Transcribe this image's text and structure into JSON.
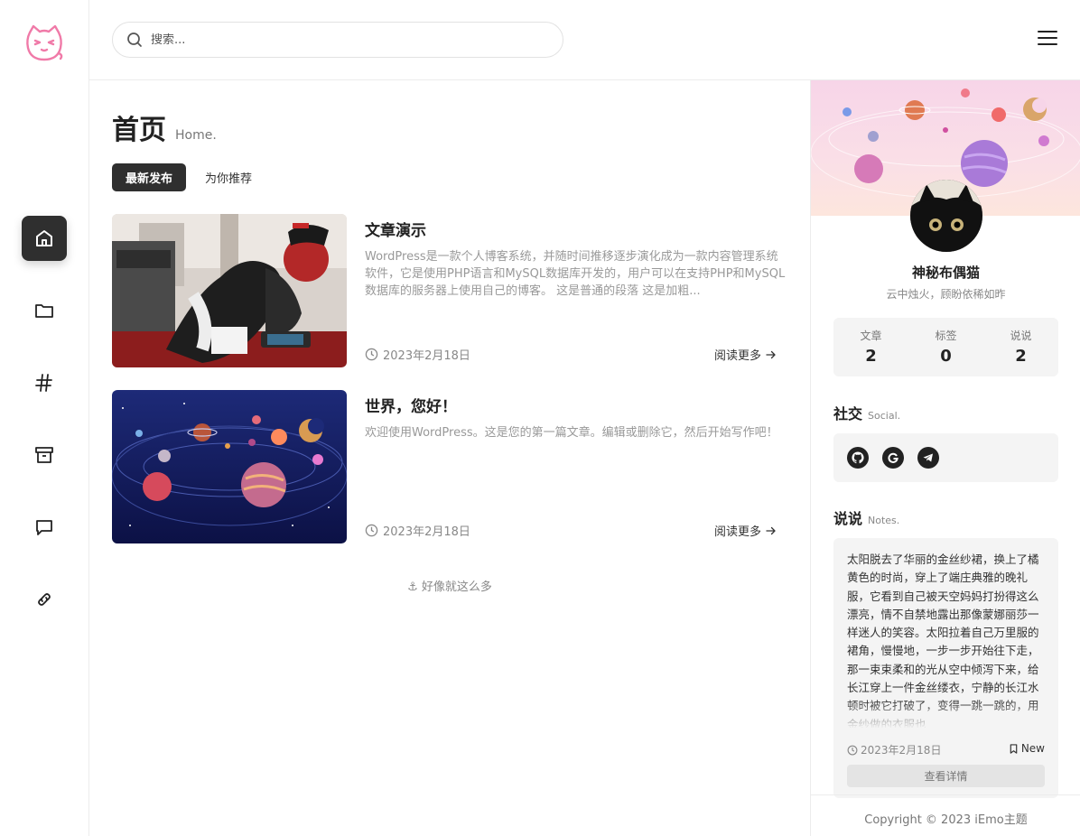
{
  "search": {
    "placeholder": "搜索..."
  },
  "nav": [
    {
      "name": "home",
      "icon": "home-icon",
      "active": true
    },
    {
      "name": "folder",
      "icon": "folder-icon"
    },
    {
      "name": "tags",
      "icon": "hash-icon"
    },
    {
      "name": "archive",
      "icon": "archive-icon"
    },
    {
      "name": "comments",
      "icon": "message-icon"
    },
    {
      "name": "links",
      "icon": "link-icon"
    }
  ],
  "page": {
    "title": "首页",
    "subtitle": "Home."
  },
  "tabs": [
    {
      "label": "最新发布",
      "active": true
    },
    {
      "label": "为你推荐"
    }
  ],
  "posts": [
    {
      "title": "文章演示",
      "excerpt": "WordPress是一款个人博客系统，并随时间推移逐步演化成为一款内容管理系统软件，它是使用PHP语言和MySQL数据库开发的，用户可以在支持PHP和MySQL数据库的服务器上使用自己的博客。 这是普通的段落 这是加粗...",
      "date": "2023年2月18日",
      "read_more": "阅读更多"
    },
    {
      "title": "世界，您好！",
      "excerpt": "欢迎使用WordPress。这是您的第一篇文章。编辑或删除它，然后开始写作吧！",
      "date": "2023年2月18日",
      "read_more": "阅读更多"
    }
  ],
  "end_note": "好像就这么多",
  "profile": {
    "name": "神秘布偶猫",
    "bio": "云中烛火，顾盼依稀如昨",
    "stats": [
      {
        "label": "文章",
        "value": "2"
      },
      {
        "label": "标签",
        "value": "0"
      },
      {
        "label": "说说",
        "value": "2"
      }
    ]
  },
  "social": {
    "title": "社交",
    "subtitle": "Social.",
    "icons": [
      "github-icon",
      "google-icon",
      "telegram-icon"
    ]
  },
  "notes": {
    "title": "说说",
    "subtitle": "Notes.",
    "text": "太阳脱去了华丽的金丝纱裙，换上了橘黄色的时尚，穿上了端庄典雅的晚礼服，它看到自己被天空妈妈打扮得这么漂亮，情不自禁地露出那像蒙娜丽莎一样迷人的笑容。太阳拉着自己万里服的裙角，慢慢地，一步一步开始往下走，那一束束柔和的光从空中倾泻下来，给长江穿上一件金丝缕衣，宁静的长江水顿时被它打破了，变得一跳一跳的，用金纱做的衣服也",
    "date": "2023年2月18日",
    "tag": "New",
    "button": "查看详情"
  },
  "footer": "Copyright © 2023 iEmo主题",
  "colors": {
    "accent": "#2f2f2f",
    "logo_pink": "#f07aa8",
    "muted": "#888888"
  }
}
